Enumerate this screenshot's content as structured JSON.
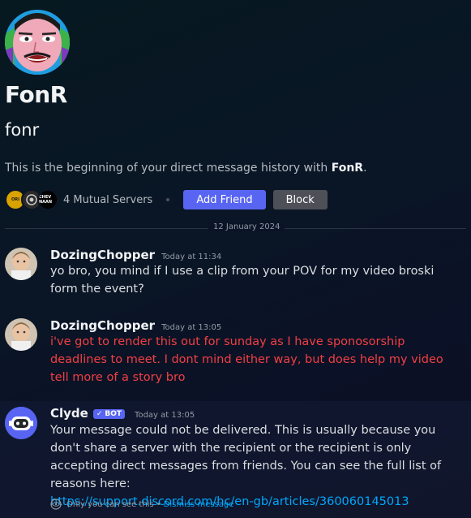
{
  "profile": {
    "display_name": "FonR",
    "username": "fonr",
    "intro_prefix": "This is the beginning of your direct message history with ",
    "intro_name": "FonR",
    "intro_suffix": ".",
    "mutual_servers": "4 Mutual Servers",
    "add_friend_label": "Add Friend",
    "block_label": "Block",
    "server_icons": [
      {
        "text": "ORI",
        "color": "#d9a300"
      },
      {
        "text": "",
        "color": "#2a2a2a"
      },
      {
        "text": "CHEV NAAN",
        "color": "#000000"
      }
    ]
  },
  "date_divider": "12 January 2024",
  "messages": [
    {
      "author": "DozingChopper",
      "time": "Today at 11:34",
      "text": "yo bro, you mind if I use a clip from your POV for my video broski form the event?"
    },
    {
      "author": "DozingChopper",
      "time": "Today at 13:05",
      "text": "i've got to render this out for sunday as I have sponosorship deadlines to meet.  I dont mind either way, but does help my video tell more of a story bro"
    },
    {
      "author": "Clyde",
      "bot_tag": "BOT",
      "time": "Today at 13:05",
      "text": "Your message could not be delivered. This is usually because you don't share a server with the recipient or the recipient is only accepting direct messages from friends. You can see the full list of reasons here:",
      "link": "https://support.discord.com/hc/en-gb/articles/360060145013",
      "note": "Only you can see this",
      "note_sep": "•",
      "dismiss": "Dismiss message"
    }
  ],
  "colors": {
    "blurple": "#5865f2",
    "error_text": "#f23f43",
    "link": "#00a8fc"
  }
}
